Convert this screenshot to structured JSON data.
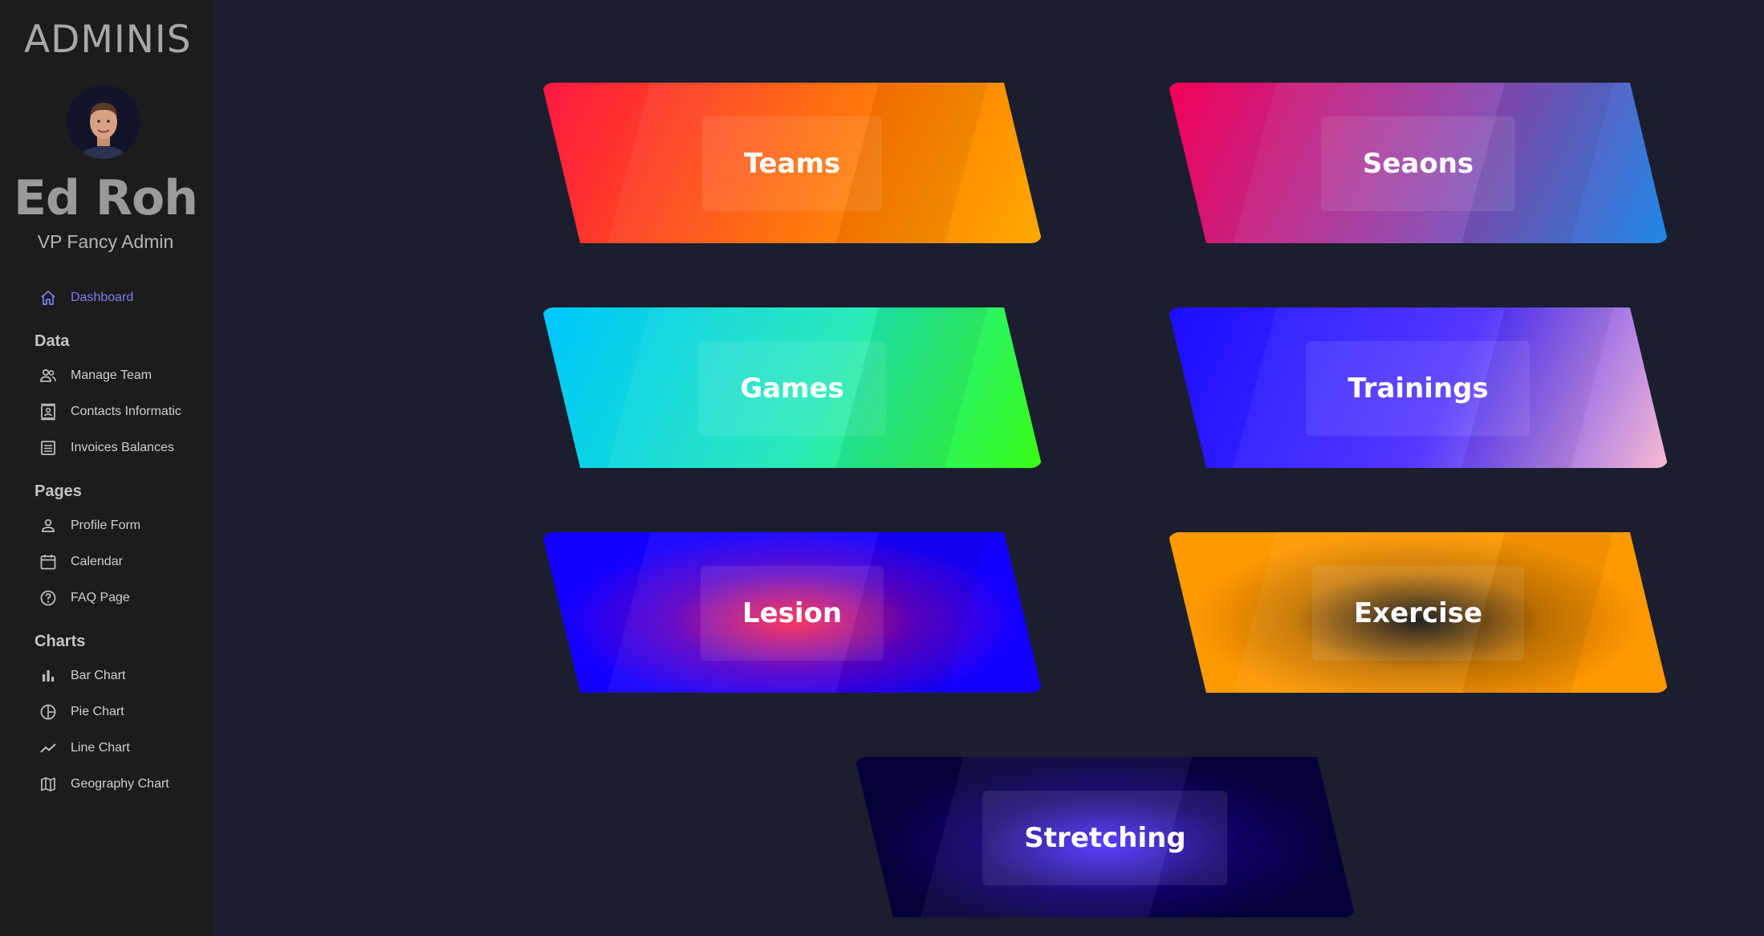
{
  "brand": "ADMINIS",
  "user": {
    "name": "Ed Roh",
    "role": "VP Fancy Admin"
  },
  "nav": {
    "dashboard": {
      "label": "Dashboard",
      "icon": "home-icon"
    },
    "sections": [
      {
        "title": "Data",
        "items": [
          {
            "label": "Manage Team",
            "icon": "people-icon"
          },
          {
            "label": "Contacts Informatic",
            "icon": "contacts-icon"
          },
          {
            "label": "Invoices Balances",
            "icon": "receipt-icon"
          }
        ]
      },
      {
        "title": "Pages",
        "items": [
          {
            "label": "Profile Form",
            "icon": "person-icon"
          },
          {
            "label": "Calendar",
            "icon": "calendar-icon"
          },
          {
            "label": "FAQ Page",
            "icon": "help-icon"
          }
        ]
      },
      {
        "title": "Charts",
        "items": [
          {
            "label": "Bar Chart",
            "icon": "bar-chart-icon"
          },
          {
            "label": "Pie Chart",
            "icon": "pie-chart-icon"
          },
          {
            "label": "Line Chart",
            "icon": "line-chart-icon"
          },
          {
            "label": "Geography Chart",
            "icon": "map-icon"
          }
        ]
      }
    ]
  },
  "cards": [
    {
      "label": "Teams",
      "colors": [
        "#ff1744",
        "#ff6d00",
        "#ffab00"
      ]
    },
    {
      "label": "Seaons",
      "colors": [
        "#f50057",
        "#8e44ad",
        "#1e88e5"
      ]
    },
    {
      "label": "Games",
      "colors": [
        "#00c6ff",
        "#1de9b6",
        "#39ff14"
      ]
    },
    {
      "label": "Trainings",
      "colors": [
        "#1a0dff",
        "#4a2dff",
        "#f8bbd0"
      ]
    },
    {
      "label": "Lesion",
      "colors": [
        "#ff1744",
        "#5a00c8",
        "#1400ff"
      ]
    },
    {
      "label": "Exercise",
      "colors": [
        "#000000",
        "#c77600",
        "#ff9900"
      ]
    },
    {
      "label": "Stretching",
      "colors": [
        "#3d22ff",
        "#12006e",
        "#05003a"
      ]
    }
  ],
  "accent": "#7b7ef0"
}
